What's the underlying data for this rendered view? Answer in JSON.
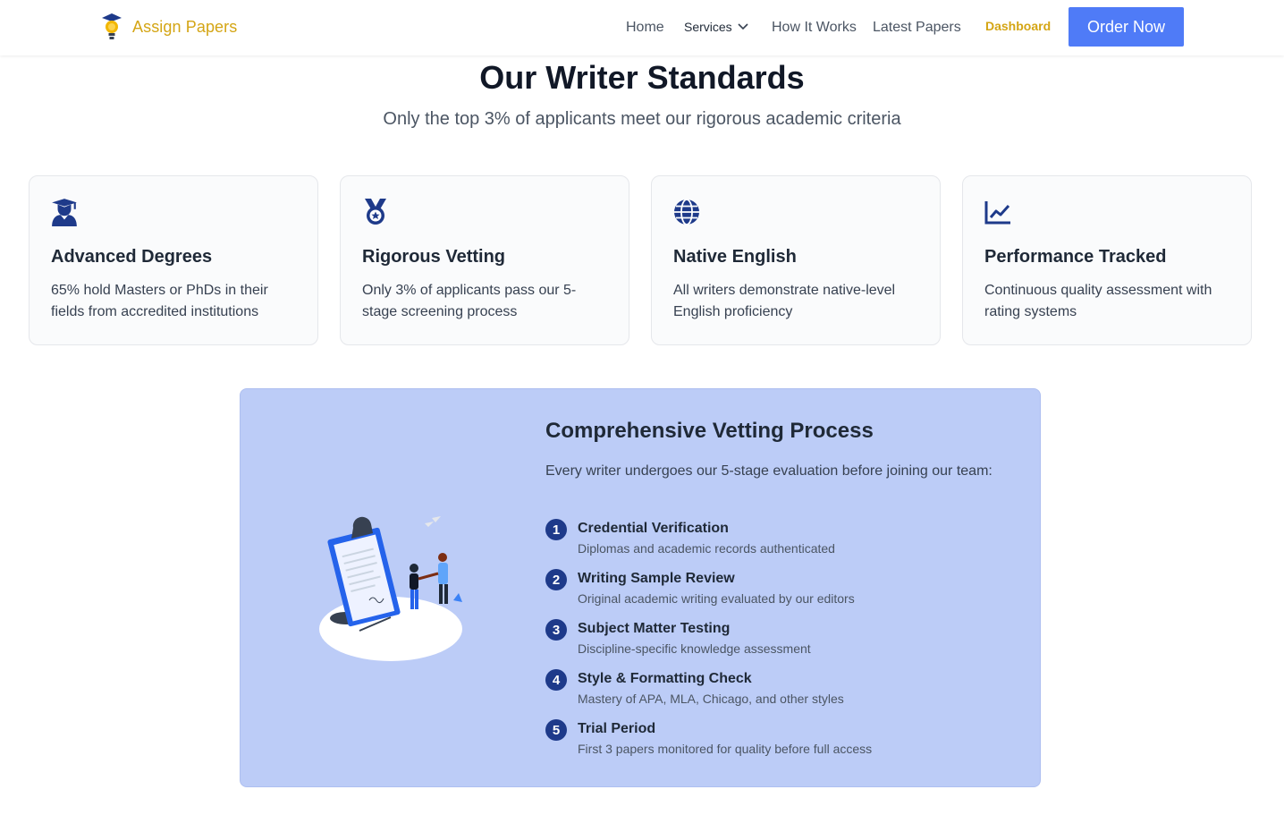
{
  "header": {
    "brand": "Assign Papers",
    "nav": {
      "home": "Home",
      "services": "Services",
      "how_it_works": "How It Works",
      "latest_papers": "Latest Papers",
      "dashboard": "Dashboard"
    },
    "order_button": "Order Now"
  },
  "hero": {
    "title": "Our Writer Standards",
    "subtitle": "Only the top 3% of applicants meet our rigorous academic criteria"
  },
  "cards": [
    {
      "icon": "graduate-icon",
      "title": "Advanced Degrees",
      "text": "65% hold Masters or PhDs in their fields from accredited institutions"
    },
    {
      "icon": "medal-icon",
      "title": "Rigorous Vetting",
      "text": "Only 3% of applicants pass our 5-stage screening process"
    },
    {
      "icon": "globe-icon",
      "title": "Native English",
      "text": "All writers demonstrate native-level English proficiency"
    },
    {
      "icon": "chart-line-icon",
      "title": "Performance Tracked",
      "text": "Continuous quality assessment with rating systems"
    }
  ],
  "vetting": {
    "title": "Comprehensive Vetting Process",
    "intro": "Every writer undergoes our 5-stage evaluation before joining our team:",
    "steps": [
      {
        "num": "1",
        "title": "Credential Verification",
        "desc": "Diplomas and academic records authenticated"
      },
      {
        "num": "2",
        "title": "Writing Sample Review",
        "desc": "Original academic writing evaluated by our editors"
      },
      {
        "num": "3",
        "title": "Subject Matter Testing",
        "desc": "Discipline-specific knowledge assessment"
      },
      {
        "num": "4",
        "title": "Style & Formatting Check",
        "desc": "Mastery of APA, MLA, Chicago, and other styles"
      },
      {
        "num": "5",
        "title": "Trial Period",
        "desc": "First 3 papers monitored for quality before full access"
      }
    ]
  },
  "colors": {
    "brand": "#d4a514",
    "primary": "#4f7bf7",
    "navy": "#1e3a8a",
    "panel": "#bcccf7"
  }
}
